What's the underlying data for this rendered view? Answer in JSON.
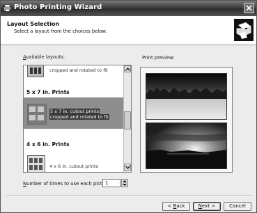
{
  "window": {
    "title": "Photo Printing Wizard",
    "title_icon": "printer-icon",
    "close_icon": "close-icon"
  },
  "header": {
    "title": "Layout Selection",
    "subtitle": "Select a layout from the choices below.",
    "icon": "printer-wizard-icon"
  },
  "layouts": {
    "label_prefix": "A",
    "label_rest": "vailable layouts:",
    "items": [
      {
        "kind": "text",
        "text": "cropped and rotated to fit"
      },
      {
        "kind": "heading",
        "text": "5 x 7 in. Prints"
      },
      {
        "kind": "selected",
        "line1": "5 x 7 in. cutout prints",
        "line2": "cropped and rotated to fit"
      },
      {
        "kind": "heading",
        "text": "4 x 6 in. Prints"
      },
      {
        "kind": "text",
        "text": "4 x 6 in. cutout prints"
      }
    ]
  },
  "preview": {
    "label": "Print preview:"
  },
  "copies": {
    "label_prefix": "N",
    "label_rest": "umber of times to use each picture:",
    "value": "1"
  },
  "buttons": {
    "back": {
      "prefix": "< ",
      "accel": "B",
      "rest": "ack"
    },
    "next": {
      "accel": "N",
      "rest": "ext >"
    },
    "cancel": "Cancel"
  },
  "colors": {
    "titlebar": "#3e3e3e",
    "selection": "#8e8e8e",
    "face": "#ececec"
  }
}
